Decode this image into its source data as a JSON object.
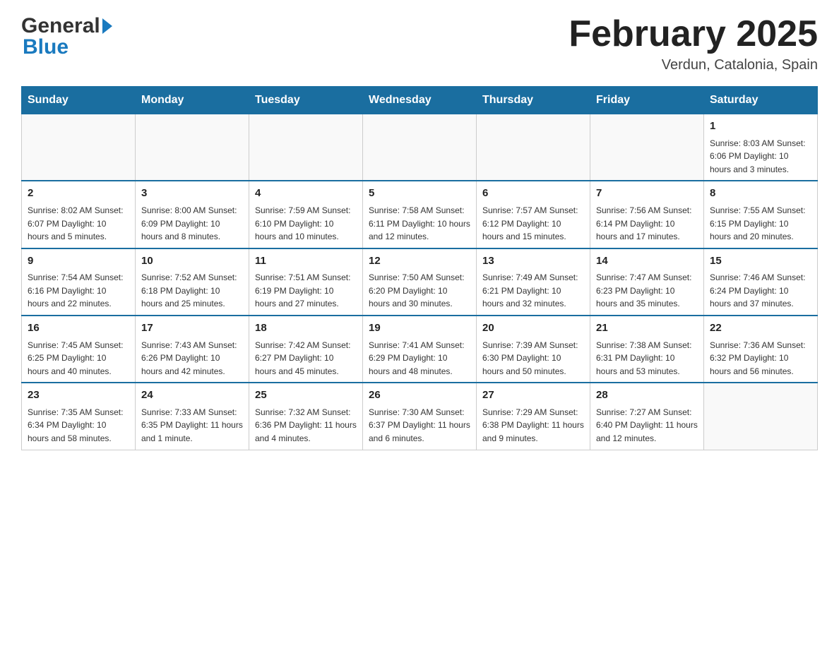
{
  "header": {
    "logo_general": "General",
    "logo_blue": "Blue",
    "title": "February 2025",
    "location": "Verdun, Catalonia, Spain"
  },
  "calendar": {
    "days_of_week": [
      "Sunday",
      "Monday",
      "Tuesday",
      "Wednesday",
      "Thursday",
      "Friday",
      "Saturday"
    ],
    "weeks": [
      [
        {
          "day": "",
          "info": ""
        },
        {
          "day": "",
          "info": ""
        },
        {
          "day": "",
          "info": ""
        },
        {
          "day": "",
          "info": ""
        },
        {
          "day": "",
          "info": ""
        },
        {
          "day": "",
          "info": ""
        },
        {
          "day": "1",
          "info": "Sunrise: 8:03 AM\nSunset: 6:06 PM\nDaylight: 10 hours and 3 minutes."
        }
      ],
      [
        {
          "day": "2",
          "info": "Sunrise: 8:02 AM\nSunset: 6:07 PM\nDaylight: 10 hours and 5 minutes."
        },
        {
          "day": "3",
          "info": "Sunrise: 8:00 AM\nSunset: 6:09 PM\nDaylight: 10 hours and 8 minutes."
        },
        {
          "day": "4",
          "info": "Sunrise: 7:59 AM\nSunset: 6:10 PM\nDaylight: 10 hours and 10 minutes."
        },
        {
          "day": "5",
          "info": "Sunrise: 7:58 AM\nSunset: 6:11 PM\nDaylight: 10 hours and 12 minutes."
        },
        {
          "day": "6",
          "info": "Sunrise: 7:57 AM\nSunset: 6:12 PM\nDaylight: 10 hours and 15 minutes."
        },
        {
          "day": "7",
          "info": "Sunrise: 7:56 AM\nSunset: 6:14 PM\nDaylight: 10 hours and 17 minutes."
        },
        {
          "day": "8",
          "info": "Sunrise: 7:55 AM\nSunset: 6:15 PM\nDaylight: 10 hours and 20 minutes."
        }
      ],
      [
        {
          "day": "9",
          "info": "Sunrise: 7:54 AM\nSunset: 6:16 PM\nDaylight: 10 hours and 22 minutes."
        },
        {
          "day": "10",
          "info": "Sunrise: 7:52 AM\nSunset: 6:18 PM\nDaylight: 10 hours and 25 minutes."
        },
        {
          "day": "11",
          "info": "Sunrise: 7:51 AM\nSunset: 6:19 PM\nDaylight: 10 hours and 27 minutes."
        },
        {
          "day": "12",
          "info": "Sunrise: 7:50 AM\nSunset: 6:20 PM\nDaylight: 10 hours and 30 minutes."
        },
        {
          "day": "13",
          "info": "Sunrise: 7:49 AM\nSunset: 6:21 PM\nDaylight: 10 hours and 32 minutes."
        },
        {
          "day": "14",
          "info": "Sunrise: 7:47 AM\nSunset: 6:23 PM\nDaylight: 10 hours and 35 minutes."
        },
        {
          "day": "15",
          "info": "Sunrise: 7:46 AM\nSunset: 6:24 PM\nDaylight: 10 hours and 37 minutes."
        }
      ],
      [
        {
          "day": "16",
          "info": "Sunrise: 7:45 AM\nSunset: 6:25 PM\nDaylight: 10 hours and 40 minutes."
        },
        {
          "day": "17",
          "info": "Sunrise: 7:43 AM\nSunset: 6:26 PM\nDaylight: 10 hours and 42 minutes."
        },
        {
          "day": "18",
          "info": "Sunrise: 7:42 AM\nSunset: 6:27 PM\nDaylight: 10 hours and 45 minutes."
        },
        {
          "day": "19",
          "info": "Sunrise: 7:41 AM\nSunset: 6:29 PM\nDaylight: 10 hours and 48 minutes."
        },
        {
          "day": "20",
          "info": "Sunrise: 7:39 AM\nSunset: 6:30 PM\nDaylight: 10 hours and 50 minutes."
        },
        {
          "day": "21",
          "info": "Sunrise: 7:38 AM\nSunset: 6:31 PM\nDaylight: 10 hours and 53 minutes."
        },
        {
          "day": "22",
          "info": "Sunrise: 7:36 AM\nSunset: 6:32 PM\nDaylight: 10 hours and 56 minutes."
        }
      ],
      [
        {
          "day": "23",
          "info": "Sunrise: 7:35 AM\nSunset: 6:34 PM\nDaylight: 10 hours and 58 minutes."
        },
        {
          "day": "24",
          "info": "Sunrise: 7:33 AM\nSunset: 6:35 PM\nDaylight: 11 hours and 1 minute."
        },
        {
          "day": "25",
          "info": "Sunrise: 7:32 AM\nSunset: 6:36 PM\nDaylight: 11 hours and 4 minutes."
        },
        {
          "day": "26",
          "info": "Sunrise: 7:30 AM\nSunset: 6:37 PM\nDaylight: 11 hours and 6 minutes."
        },
        {
          "day": "27",
          "info": "Sunrise: 7:29 AM\nSunset: 6:38 PM\nDaylight: 11 hours and 9 minutes."
        },
        {
          "day": "28",
          "info": "Sunrise: 7:27 AM\nSunset: 6:40 PM\nDaylight: 11 hours and 12 minutes."
        },
        {
          "day": "",
          "info": ""
        }
      ]
    ]
  }
}
